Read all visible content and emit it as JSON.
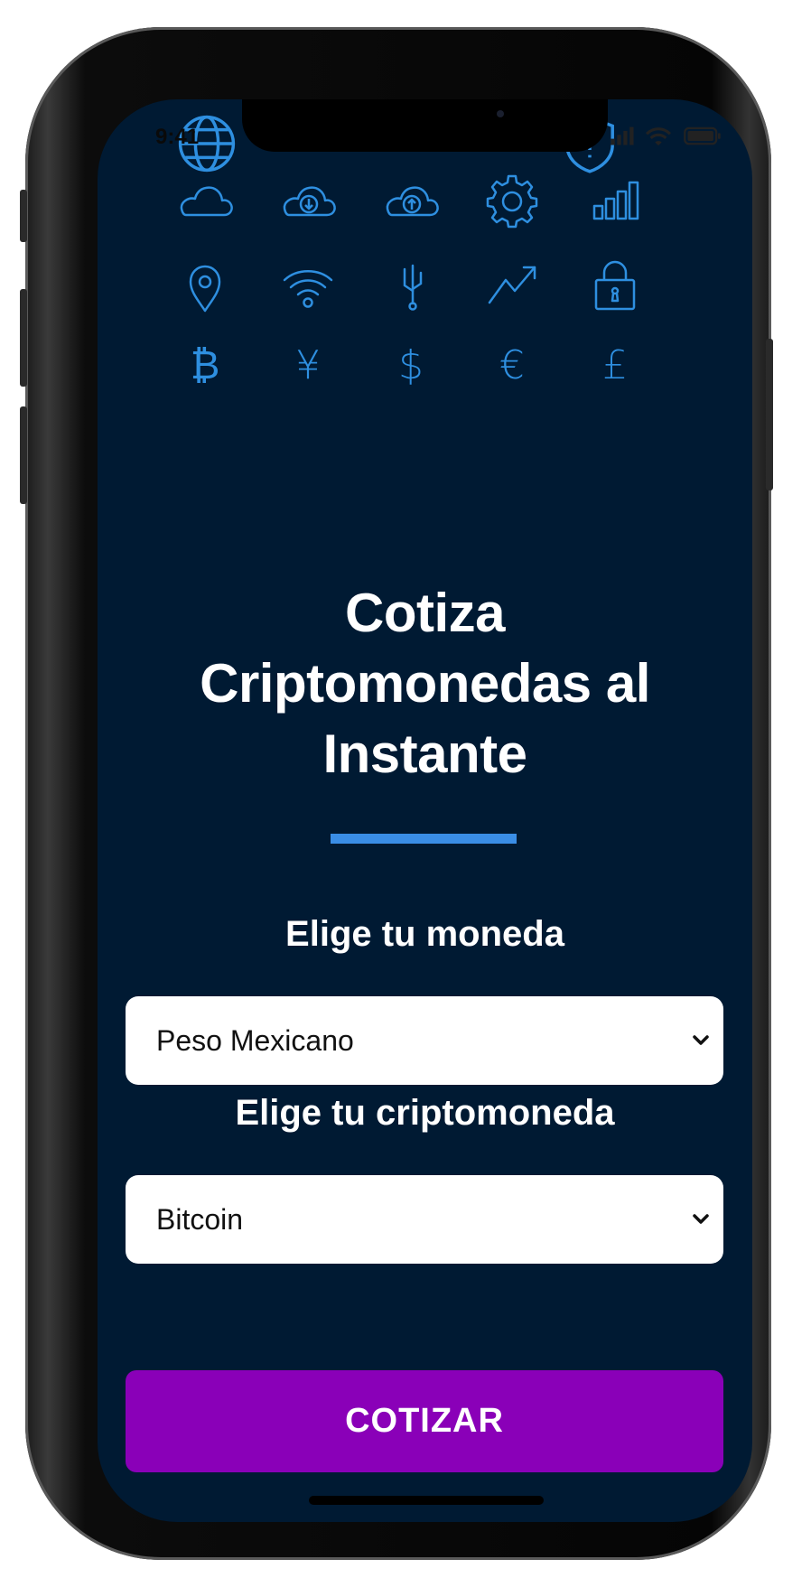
{
  "status_bar": {
    "time": "9:41"
  },
  "icons": [
    {
      "name": "cloud-icon"
    },
    {
      "name": "cloud-download-icon"
    },
    {
      "name": "cloud-upload-icon"
    },
    {
      "name": "gear-icon"
    },
    {
      "name": "bar-chart-icon"
    },
    {
      "name": "map-pin-icon"
    },
    {
      "name": "wifi-icon"
    },
    {
      "name": "usb-fork-icon"
    },
    {
      "name": "trend-up-icon"
    },
    {
      "name": "padlock-icon"
    },
    {
      "name": "bitcoin-icon",
      "glyph": "₿"
    },
    {
      "name": "yen-icon",
      "glyph": "¥"
    },
    {
      "name": "dollar-icon",
      "glyph": "$"
    },
    {
      "name": "euro-icon",
      "glyph": "€"
    },
    {
      "name": "pound-icon",
      "glyph": "£"
    }
  ],
  "hero": {
    "title_line1": "Cotiza",
    "title_line2": "Criptomonedas al",
    "title_line3": "Instante"
  },
  "form": {
    "currency_label": "Elige tu moneda",
    "currency_value": "Peso Mexicano",
    "crypto_label": "Elige tu criptomoneda",
    "crypto_value": "Bitcoin",
    "submit_label": "COTIZAR"
  },
  "colors": {
    "background": "#001a33",
    "accent_icons": "#2e8fe0",
    "title_bar": "#3a8ee6",
    "button": "#8a00b8"
  }
}
